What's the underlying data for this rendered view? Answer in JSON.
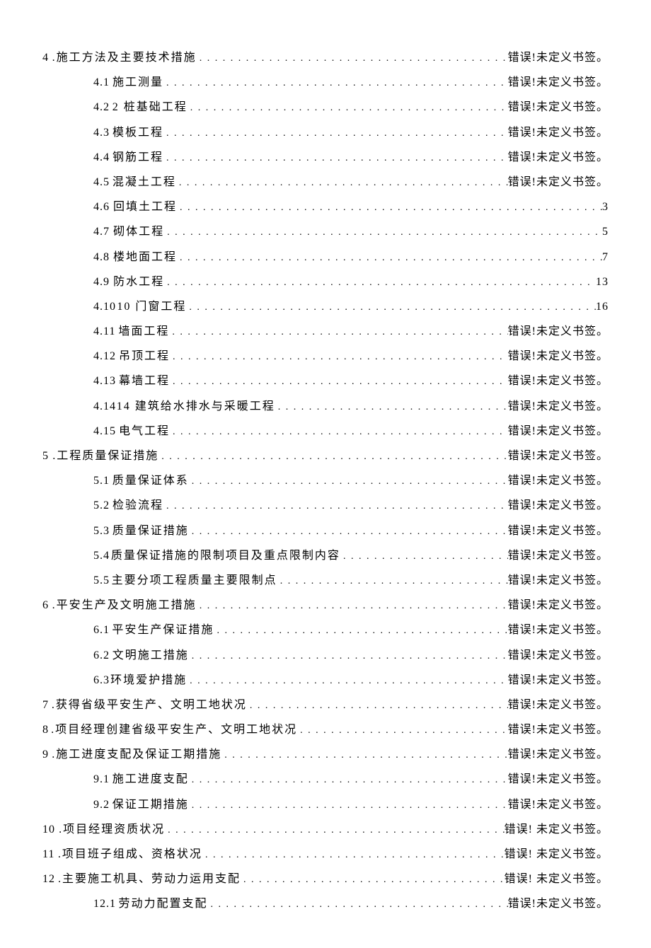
{
  "error_text": "错误!未定义书签。",
  "error_text_spaced": "错误! 未定义书签。",
  "entries": [
    {
      "indent": 0,
      "num": "4",
      "sep": "wide",
      "title": ".施工方法及主要技术措施",
      "page_key": "error_text"
    },
    {
      "indent": 1,
      "num": "4.1",
      "sep": "med",
      "title": "施工测量",
      "page_key": "error_text"
    },
    {
      "indent": 1,
      "num": "4.2",
      "sep": "med",
      "title": "2 桩基础工程",
      "page_key": "error_text"
    },
    {
      "indent": 1,
      "num": "4.3",
      "sep": "med",
      "title": "模板工程",
      "page_key": "error_text"
    },
    {
      "indent": 1,
      "num": "4.4",
      "sep": "med",
      "title": "钢筋工程",
      "page_key": "error_text"
    },
    {
      "indent": 1,
      "num": "4.5",
      "sep": "med",
      "title": "混凝土工程",
      "page_key": "error_text"
    },
    {
      "indent": 1,
      "num": "4.6",
      "sep": "med",
      "title": "回填土工程",
      "page": "3"
    },
    {
      "indent": 1,
      "num": "4.7",
      "sep": "med",
      "title": "砌体工程",
      "page": "5"
    },
    {
      "indent": 1,
      "num": "4.8",
      "sep": "med",
      "title": "楼地面工程",
      "page": "7"
    },
    {
      "indent": 1,
      "num": "4.9",
      "sep": "med",
      "title": "防水工程",
      "page": "13"
    },
    {
      "indent": 1,
      "num": "4.10",
      "sep": "none",
      "title": "10 门窗工程",
      "page": "16"
    },
    {
      "indent": 1,
      "num": "4.11",
      "sep": "med",
      "title": "墙面工程",
      "page_key": "error_text"
    },
    {
      "indent": 1,
      "num": "4.12",
      "sep": "med",
      "title": "吊顶工程",
      "page_key": "error_text"
    },
    {
      "indent": 1,
      "num": "4.13",
      "sep": "med",
      "title": "幕墙工程",
      "page_key": "error_text"
    },
    {
      "indent": 1,
      "num": "4.14",
      "sep": "none",
      "title": "14 建筑给水排水与采暖工程",
      "page_key": "error_text"
    },
    {
      "indent": 1,
      "num": "4.15",
      "sep": "med",
      "title": "电气工程",
      "page_key": "error_text"
    },
    {
      "indent": 0,
      "num": "5",
      "sep": "wide",
      "title": ".工程质量保证措施",
      "page_key": "error_text"
    },
    {
      "indent": 1,
      "num": "5.1",
      "sep": "med",
      "title": "质量保证体系",
      "page_key": "error_text"
    },
    {
      "indent": 1,
      "num": "5.2",
      "sep": "med",
      "title": "检验流程",
      "page_key": "error_text"
    },
    {
      "indent": 1,
      "num": "5.3",
      "sep": "med",
      "title": "质量保证措施",
      "page_key": "error_text"
    },
    {
      "indent": 1,
      "num": "5.4",
      "sep": "med",
      "title": "质量保证措施的限制项目及重点限制内容",
      "page_key": "error_text"
    },
    {
      "indent": 1,
      "num": "5.5",
      "sep": "med",
      "title": "主要分项工程质量主要限制点",
      "page_key": "error_text"
    },
    {
      "indent": 0,
      "num": "6",
      "sep": "wide",
      "title": ".平安生产及文明施工措施",
      "page_key": "error_text"
    },
    {
      "indent": 1,
      "num": "6.1",
      "sep": "med",
      "title": "平安生产保证措施",
      "page_key": "error_text"
    },
    {
      "indent": 1,
      "num": "6.2",
      "sep": "med",
      "title": "文明施工措施",
      "page_key": "error_text"
    },
    {
      "indent": 1,
      "num": "6.3",
      "sep": "none",
      "title": "环境爱护措施",
      "page_key": "error_text"
    },
    {
      "indent": 0,
      "num": "7",
      "sep": "wide",
      "title": ".获得省级平安生产、文明工地状况",
      "page_key": "error_text"
    },
    {
      "indent": 0,
      "num": "8",
      "sep": "wide",
      "title": ".项目经理创建省级平安生产、文明工地状况",
      "page_key": "error_text"
    },
    {
      "indent": 0,
      "num": "9",
      "sep": "wide",
      "title": ".施工进度支配及保证工期措施",
      "page_key": "error_text"
    },
    {
      "indent": 1,
      "num": "9.1",
      "sep": "med",
      "title": "施工进度支配",
      "page_key": "error_text"
    },
    {
      "indent": 1,
      "num": "9.2",
      "sep": "med",
      "title": "保证工期措施",
      "page_key": "error_text"
    },
    {
      "indent": 0,
      "num": "10",
      "sep": "wide",
      "title": ".项目经理资质状况",
      "page_key": "error_text_spaced"
    },
    {
      "indent": 0,
      "num": "11",
      "sep": "wide",
      "title": ".项目班子组成、资格状况",
      "page_key": "error_text_spaced"
    },
    {
      "indent": 0,
      "num": "12",
      "sep": "wide",
      "title": ".主要施工机具、劳动力运用支配",
      "page_key": "error_text_spaced"
    },
    {
      "indent": 1,
      "num": "12.1",
      "sep": "med",
      "title": "劳动力配置支配",
      "page_key": "error_text"
    }
  ]
}
